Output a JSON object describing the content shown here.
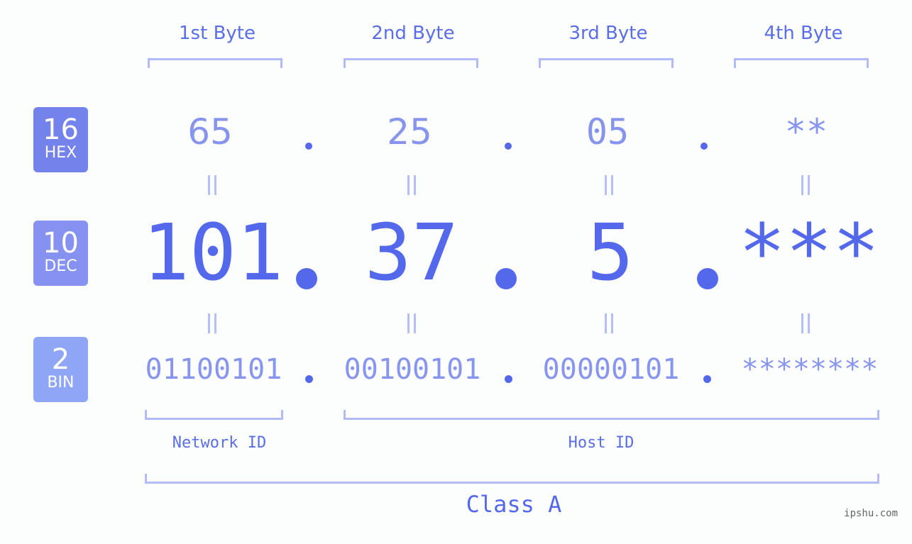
{
  "headers": [
    "1st Byte",
    "2nd Byte",
    "3rd Byte",
    "4th Byte"
  ],
  "bases": [
    {
      "number": "16",
      "label": "HEX",
      "color": "#7482ec"
    },
    {
      "number": "10",
      "label": "DEC",
      "color": "#8592f0"
    },
    {
      "number": "2",
      "label": "BIN",
      "color": "#8fa6f6"
    }
  ],
  "hex": [
    "65",
    "25",
    "05",
    "**"
  ],
  "dec": [
    "101",
    "37",
    "5",
    "***"
  ],
  "bin": [
    "01100101",
    "00100101",
    "00000101",
    "********"
  ],
  "network_id_label": "Network ID",
  "host_id_label": "Host ID",
  "class_label": "Class A",
  "watermark": "ipshu.com",
  "colors": {
    "accent": "#5468ec",
    "bracket": "#b2bbf7",
    "light_text": "#8794ee"
  }
}
